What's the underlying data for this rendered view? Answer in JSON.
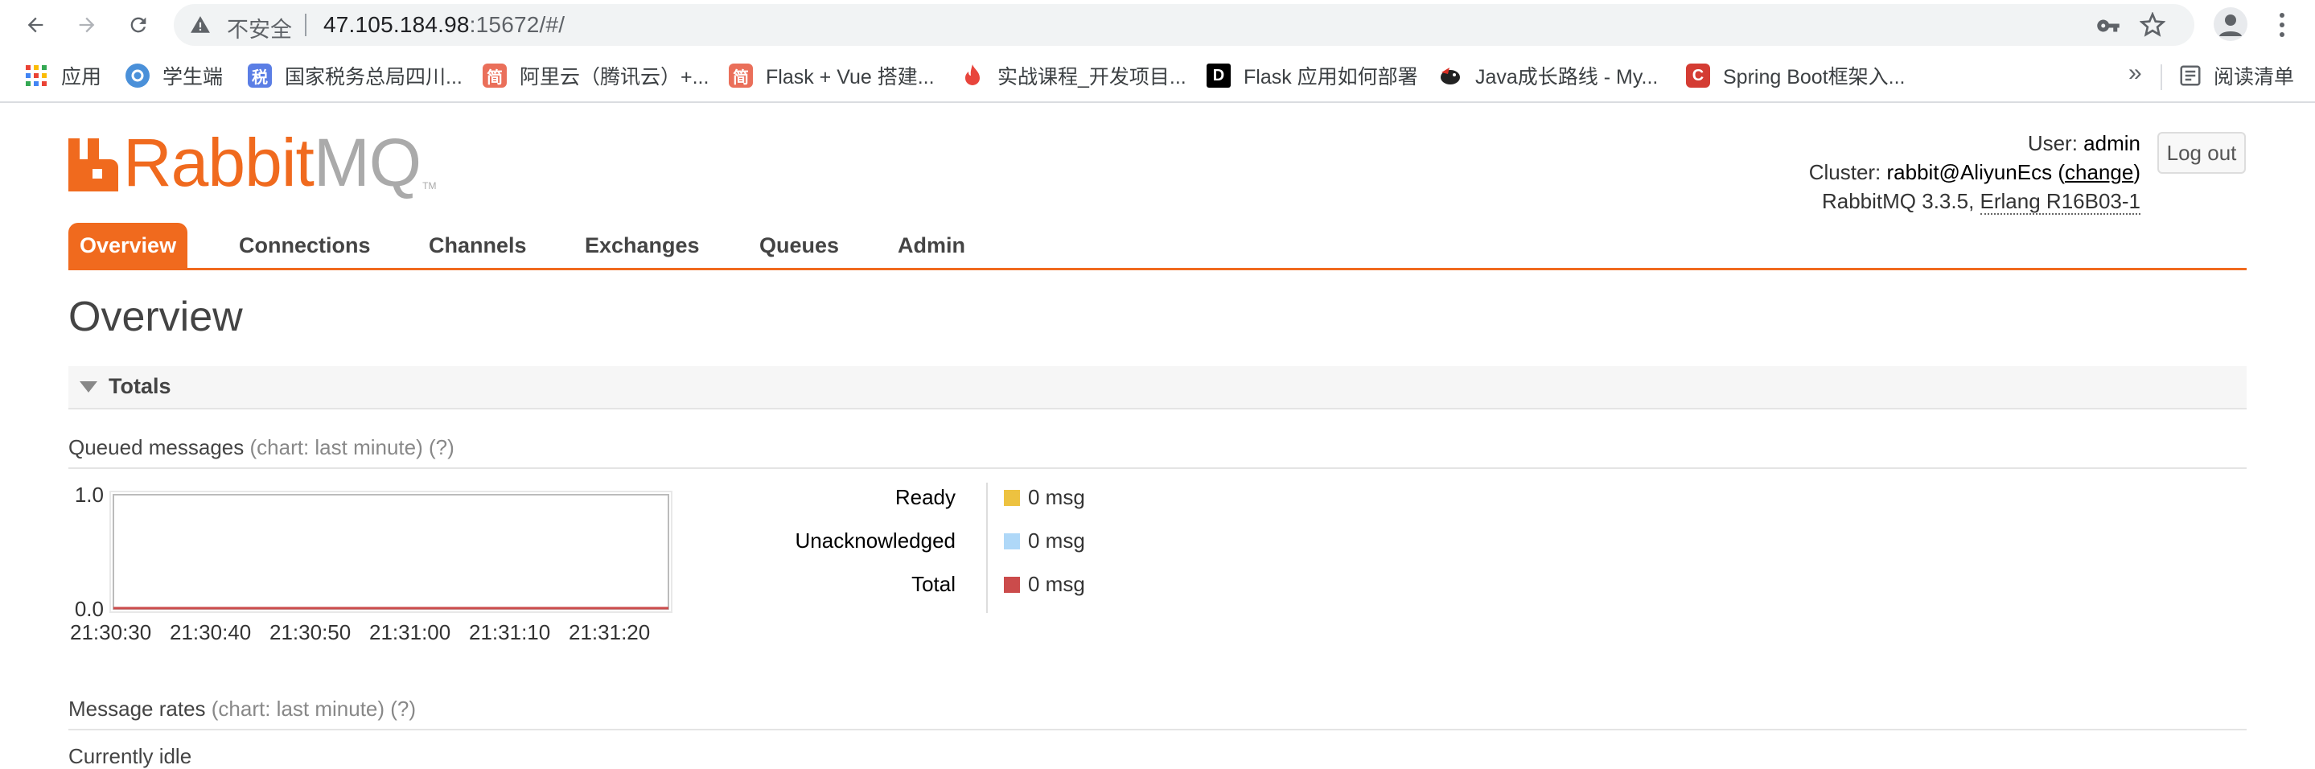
{
  "browser": {
    "insecure_label": "不安全",
    "url_host": "47.105.184.98",
    "url_path": ":15672/#/",
    "bookmarks": [
      {
        "label": "应用",
        "icon": "apps-grid-icon",
        "color": "#ea4335"
      },
      {
        "label": "学生端",
        "icon": "student-app-icon",
        "color": "#4a90d9"
      },
      {
        "label": "国家税务总局四川...",
        "icon": "tax-bureau-icon",
        "color": "#5b7ee5",
        "glyph": "税"
      },
      {
        "label": "阿里云（腾讯云）+...",
        "icon": "jianshu-icon",
        "color": "#ea6f5a",
        "glyph": "简"
      },
      {
        "label": "Flask + Vue 搭建...",
        "icon": "jianshu-icon",
        "color": "#ea6f5a",
        "glyph": "简"
      },
      {
        "label": "实战课程_开发项目...",
        "icon": "flame-icon",
        "color": "#e8453c"
      },
      {
        "label": "Flask 应用如何部署",
        "icon": "dct-logo-icon",
        "color": "#000000",
        "glyph": "D"
      },
      {
        "label": "Java成长路线 - My...",
        "icon": "bird-icon",
        "color": "#d93025"
      },
      {
        "label": "Spring Boot框架入...",
        "icon": "csdn-icon",
        "color": "#d43c33",
        "glyph": "C"
      }
    ],
    "more_label": "»",
    "reading_list_label": "阅读清单"
  },
  "header": {
    "logo": {
      "rabbit": "Rabbit",
      "mq": "MQ",
      "tm": "TM"
    },
    "user_label": "User:",
    "user_value": "admin",
    "cluster_label": "Cluster:",
    "cluster_value": "rabbit@AliyunEcs",
    "cluster_change_open": "(",
    "cluster_change": "change",
    "cluster_change_close": ")",
    "version": "RabbitMQ 3.3.5,",
    "erlang": "Erlang R16B03-1",
    "logout": "Log out"
  },
  "tabs": [
    "Overview",
    "Connections",
    "Channels",
    "Exchanges",
    "Queues",
    "Admin"
  ],
  "page_title": "Overview",
  "totals": {
    "section_label": "Totals",
    "queued_title": "Queued messages",
    "queued_hint": "(chart: last minute) (?)",
    "rates_title": "Message rates",
    "rates_hint": "(chart: last minute) (?)",
    "cutoff_text": "Currently idle",
    "stats": [
      {
        "label": "Ready",
        "value": "0 msg",
        "color": "#edc240"
      },
      {
        "label": "Unacknowledged",
        "value": "0 msg",
        "color": "#afd8f8"
      },
      {
        "label": "Total",
        "value": "0 msg",
        "color": "#cb4b4b"
      }
    ]
  },
  "chart_data": {
    "type": "line",
    "title": "",
    "xlabel": "",
    "ylabel": "",
    "x": [
      "21:30:30",
      "21:30:40",
      "21:30:50",
      "21:31:00",
      "21:31:10",
      "21:31:20"
    ],
    "y_ticks": [
      "1.0",
      "0.0"
    ],
    "ylim": [
      0,
      1
    ],
    "series": [
      {
        "name": "Ready",
        "values": [
          0,
          0,
          0,
          0,
          0,
          0
        ],
        "color": "#edc240"
      },
      {
        "name": "Unacknowledged",
        "values": [
          0,
          0,
          0,
          0,
          0,
          0
        ],
        "color": "#afd8f8"
      },
      {
        "name": "Total",
        "values": [
          0,
          0,
          0,
          0,
          0,
          0
        ],
        "color": "#cb4b4b"
      }
    ],
    "grid": false,
    "legend": "right"
  }
}
